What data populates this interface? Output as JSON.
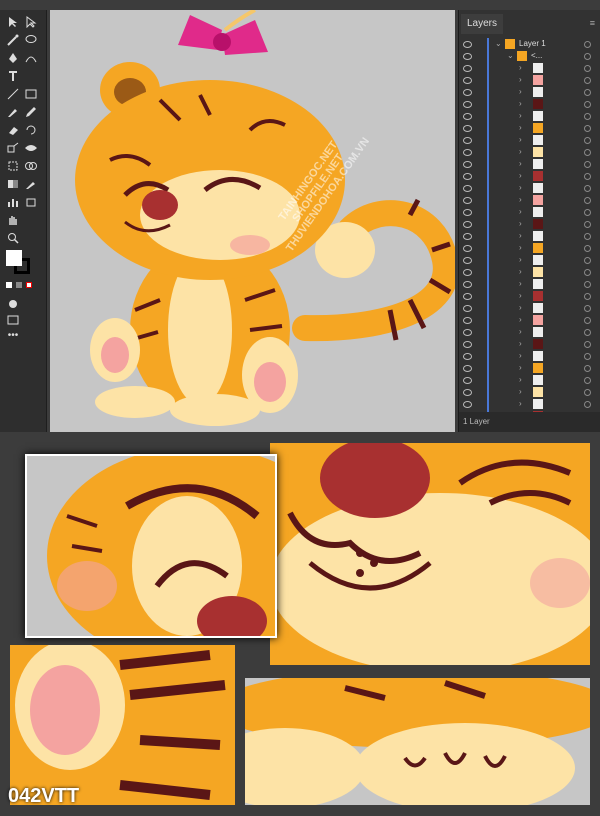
{
  "layers_panel": {
    "tab_label": "Layers",
    "top_layer_name": "Layer 1",
    "sub_layer_name": "<...",
    "footer_label": "1 Layer"
  },
  "watermark": {
    "line1": "TAINHINGOC.NET",
    "line2": "SHOPFILE.NET",
    "line3": "THUVIENDOHOA.COM.VN"
  },
  "product_code": "042VTT",
  "colors": {
    "tiger_orange": "#f5a623",
    "tiger_light": "#fde3a6",
    "stripe": "#5a1616",
    "bow_pink": "#e02a8a",
    "nose": "#a83030",
    "canvas_gray": "#c6c6c6"
  }
}
